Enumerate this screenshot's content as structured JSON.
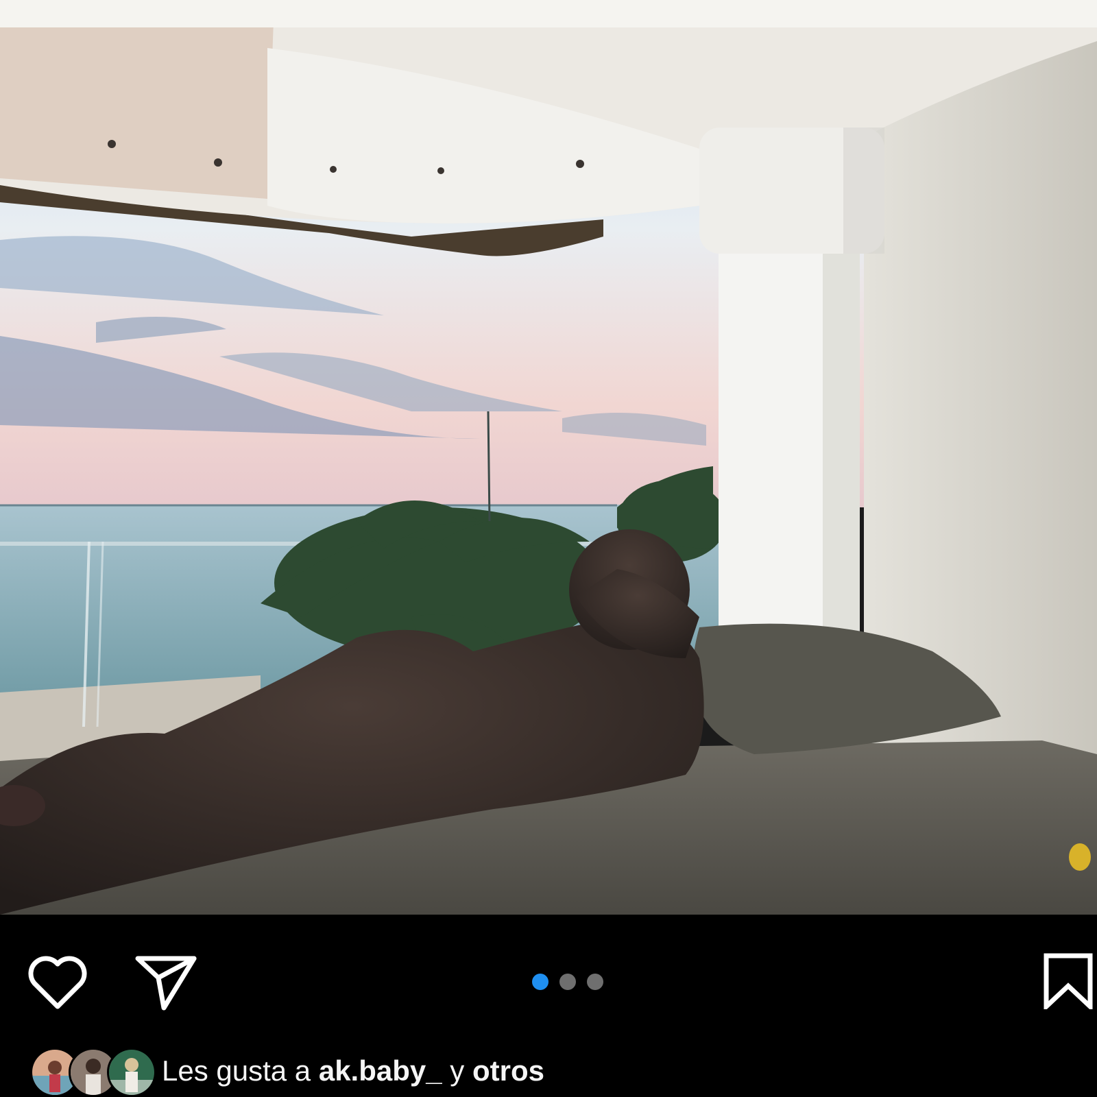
{
  "post": {
    "image": {
      "alt": "Person lying on a daybed facing an ocean view at sunset",
      "colors": {
        "sky_top": "#c9dff0",
        "sky_bottom": "#f2d8d0",
        "sea": "#8fb3bd",
        "palm": "#2b4a2f",
        "ceiling": "#efefec",
        "wall": "#d9d6ce",
        "bed": "#5a5750",
        "figure": "#2b2422"
      }
    },
    "actions": {
      "like_icon": "heart-icon",
      "share_icon": "paper-plane-icon",
      "save_icon": "bookmark-icon",
      "icon_color": "#ffffff"
    },
    "carousel": {
      "total": 3,
      "current": 1,
      "active_color": "#1f8ff0",
      "inactive_color": "#6f6f6f"
    },
    "likes": {
      "prefix": "Les gusta a",
      "user": "ak.baby_",
      "connector": "y",
      "others": "otros"
    }
  }
}
